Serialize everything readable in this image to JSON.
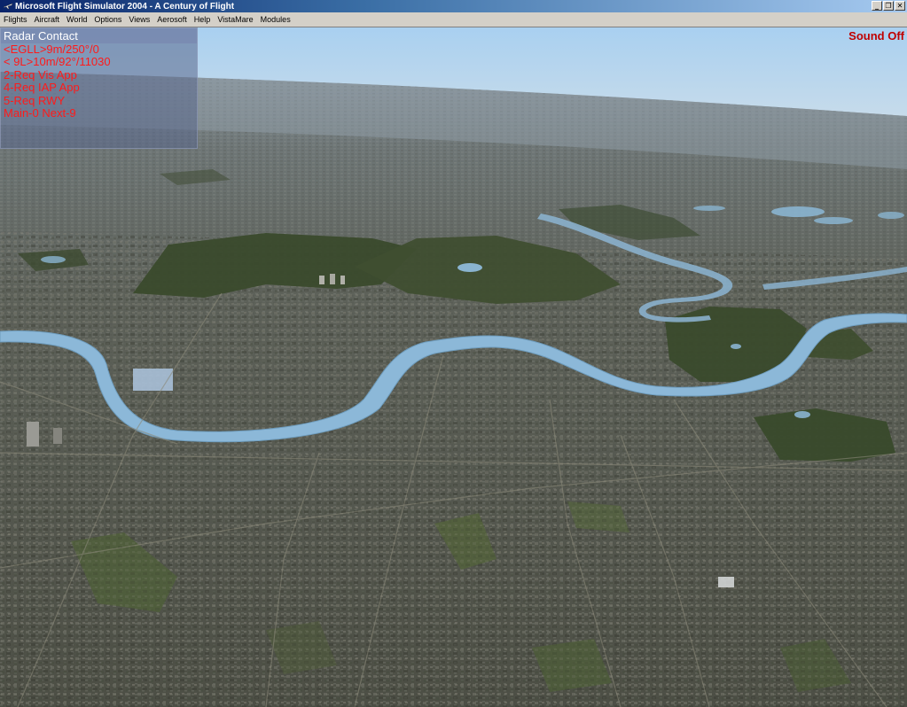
{
  "window": {
    "title": "Microsoft Flight Simulator 2004 - A Century of Flight",
    "app_icon": "plane-icon",
    "controls": [
      "minimize-icon",
      "restore-icon",
      "close-icon"
    ]
  },
  "menubar": {
    "items": [
      "Flights",
      "Aircraft",
      "World",
      "Options",
      "Views",
      "Aerosoft",
      "Help",
      "VistaMare",
      "Modules"
    ]
  },
  "radar_contact": {
    "title": "Radar Contact",
    "lines": [
      "<EGLL>9m/250°/0",
      "< 9L>10m/92°/11030",
      "",
      "2-Req Vis App",
      "",
      "4-Req IAP App",
      "5-Req RWY",
      "Main-0 Next-9"
    ],
    "text_color": "#ff1a1a"
  },
  "status": {
    "sound": "Sound Off",
    "sound_color": "#c00000"
  },
  "scene": {
    "sky_top": "#a9d0f0",
    "haze": "#8a9aa8",
    "water": "#8cb8d8",
    "park": "#3a4a2c",
    "city": "#56584e"
  }
}
